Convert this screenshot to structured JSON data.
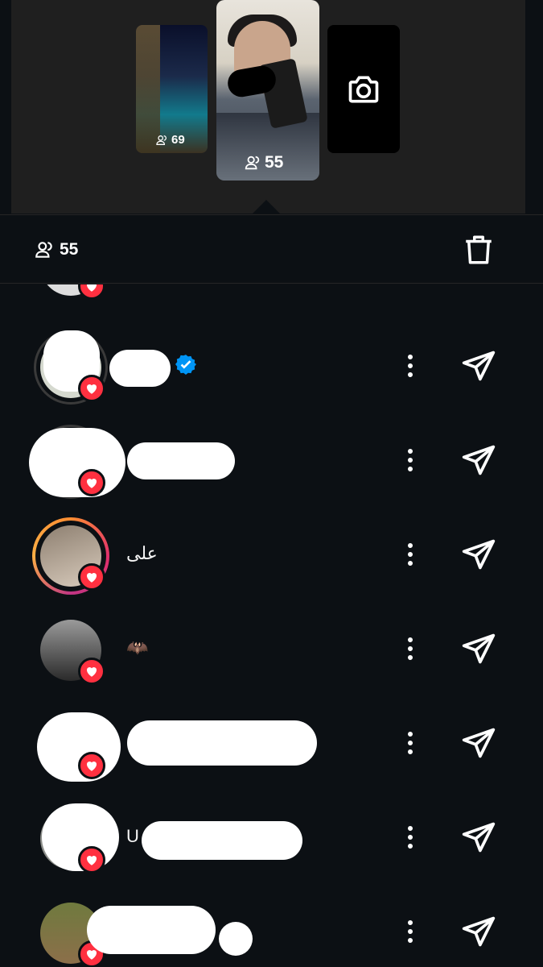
{
  "stories": {
    "thumbnails": [
      {
        "kind": "photo",
        "viewer_count": "69"
      },
      {
        "kind": "photo",
        "viewer_count": "55",
        "selected": true
      },
      {
        "kind": "camera",
        "icon": "camera-icon"
      }
    ]
  },
  "header": {
    "viewer_count": "55",
    "delete_icon": "trash-icon"
  },
  "viewers": [
    {
      "name": "",
      "verified": true,
      "ring": "grey",
      "liked": true
    },
    {
      "name": "",
      "ring": "grey",
      "liked": true
    },
    {
      "name": "على",
      "ring": "gradient",
      "liked": true
    },
    {
      "name": "🦇",
      "ring": "none",
      "liked": true
    },
    {
      "name": "",
      "ring": "none",
      "liked": true
    },
    {
      "name": "U",
      "ring": "none",
      "liked": true
    },
    {
      "name": "",
      "ring": "none",
      "liked": true
    }
  ],
  "colors": {
    "background": "#0c1014",
    "strip": "#1f1f1f",
    "heart": "#ff3040",
    "verified": "#0095f6"
  }
}
